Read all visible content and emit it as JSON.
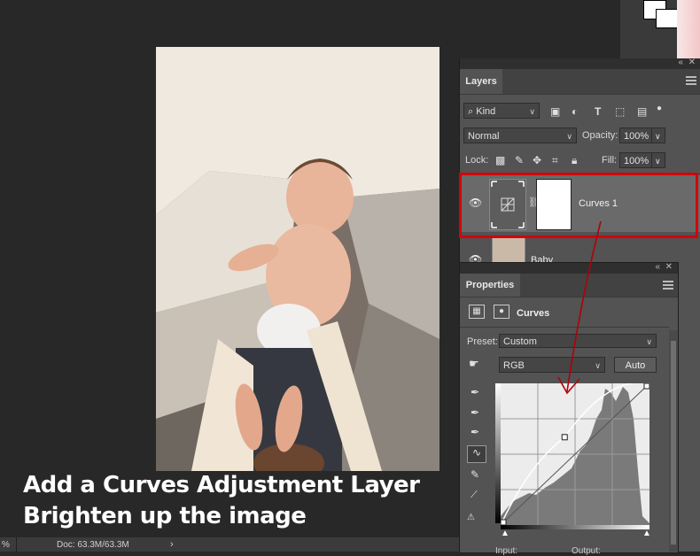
{
  "layers_panel": {
    "tab_label": "Layers",
    "filter": {
      "icon": "search-icon",
      "value": "Kind"
    },
    "blend_mode": "Normal",
    "opacity_label": "Opacity:",
    "opacity_value": "100%",
    "lock_label": "Lock:",
    "fill_label": "Fill:",
    "fill_value": "100%",
    "layers": [
      {
        "name": "Curves 1",
        "type": "curves-adjustment",
        "visible": true,
        "selected": true
      },
      {
        "name": "Baby",
        "type": "image",
        "visible": true
      }
    ]
  },
  "properties_panel": {
    "tab_label": "Properties",
    "title": "Curves",
    "preset_label": "Preset:",
    "preset_value": "Custom",
    "channel_value": "RGB",
    "auto_button": "Auto",
    "input_label": "Input:",
    "output_label": "Output:",
    "curve_points": [
      [
        0,
        0
      ],
      [
        0.43,
        0.62
      ],
      [
        1,
        1
      ]
    ]
  },
  "status": {
    "zoom": "%",
    "doc": "Doc: 63.3M/63.3M"
  },
  "caption": {
    "line1": "Add a Curves Adjustment Layer",
    "line2": "Brighten up the image"
  },
  "colors": {
    "highlight": "#d4000a",
    "panel": "#535353",
    "canvas_bg": "#282828"
  }
}
